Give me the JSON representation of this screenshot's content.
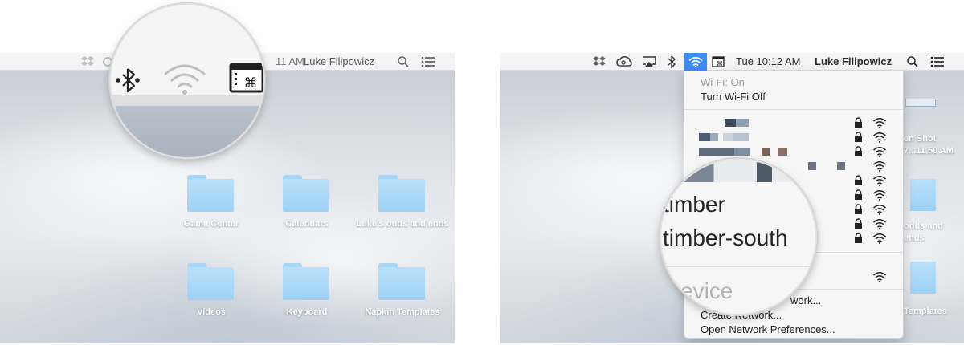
{
  "left_panel": {
    "menubar": {
      "time_partial": "11 AM",
      "user": "Luke Filipowicz"
    },
    "folders": [
      {
        "label": "Game Center"
      },
      {
        "label": "Calendars"
      },
      {
        "label": "Luke's odds and ends"
      },
      {
        "label": "Videos"
      },
      {
        "label": "Keyboard"
      },
      {
        "label": "Napkin Templates"
      }
    ]
  },
  "right_panel": {
    "menubar": {
      "time": "Tue 10:12 AM",
      "user": "Luke Filipowicz"
    },
    "wifi_menu": {
      "status": "Wi-Fi: On",
      "toggle": "Turn Wi-Fi Off",
      "device_section_partial": "evice",
      "join_other_partial": "work...",
      "create_network": "Create Network...",
      "open_prefs": "Open Network Preferences..."
    },
    "magnifier": {
      "network_1": "timber",
      "network_2": "timber-south"
    },
    "desktop_partial": {
      "screenshot_line1": "en Shot",
      "screenshot_line2": "7...11.50 AM",
      "folder_partial_line1": "odds and",
      "folder_partial_line2": "ends",
      "folder_partial_2": "Templates"
    }
  },
  "colors": {
    "accent_blue": "#3b8cf5",
    "folder_blue": "#a9d6f7",
    "menubar_bg": "#f4f4f4"
  }
}
